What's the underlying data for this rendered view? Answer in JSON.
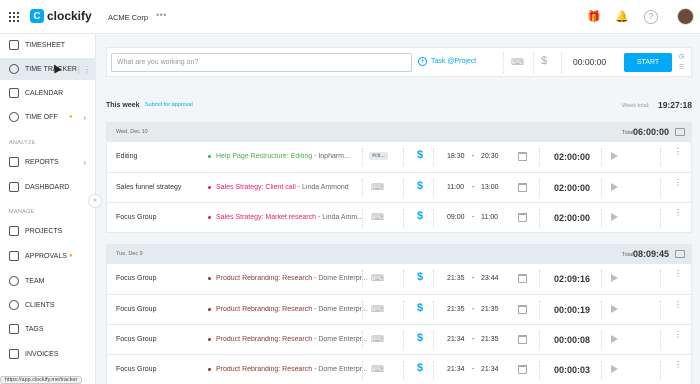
{
  "app": {
    "brand": "clockify",
    "workspace": "ACME Corp",
    "workspace_menu": "•••"
  },
  "topbar": {
    "icons": [
      "apps-grid-icon",
      "workspace-dots-icon",
      "gift-icon",
      "bell-icon",
      "help-icon",
      "avatar"
    ]
  },
  "sidebar": {
    "items": [
      {
        "label": "TIMESHEET",
        "icon": "timesheet-icon"
      },
      {
        "label": "TIME TRACKER",
        "icon": "clock-icon",
        "active": true
      },
      {
        "label": "CALENDAR",
        "icon": "calendar-icon"
      },
      {
        "label": "TIME OFF",
        "icon": "time-off-icon"
      }
    ],
    "sections": {
      "analyze": "ANALYZE",
      "manage": "MANAGE"
    },
    "analyze_items": [
      {
        "label": "REPORTS",
        "icon": "reports-icon"
      },
      {
        "label": "DASHBOARD",
        "icon": "dashboard-icon"
      }
    ],
    "manage_items": [
      {
        "label": "PROJECTS",
        "icon": "projects-icon"
      },
      {
        "label": "APPROVALS",
        "icon": "approvals-icon"
      },
      {
        "label": "TEAM",
        "icon": "team-icon"
      },
      {
        "label": "CLIENTS",
        "icon": "clients-icon"
      },
      {
        "label": "TAGS",
        "icon": "tags-icon"
      },
      {
        "label": "INVOICES",
        "icon": "invoices-icon"
      }
    ],
    "collapse": "«"
  },
  "tracker": {
    "placeholder": "What are you working on?",
    "project_label": "Task @Project",
    "time": "00:00:00",
    "start_label": "START",
    "accent": "#03a9f4"
  },
  "week": {
    "label": "This week",
    "approval_link": "Submit for approval",
    "total_label": "Week total:",
    "total": "19:27:18"
  },
  "days": [
    {
      "date": "Wed, Dec 10",
      "total_label": "Total:",
      "total": "06:00:00",
      "entries": [
        {
          "desc": "Editing",
          "project": "Help Page Restructure: Editing",
          "client": "- Inpharm...",
          "color": "#4caf50",
          "tag": "#cli...",
          "start": "18:30",
          "end": "20:30",
          "duration": "02:00:00"
        },
        {
          "desc": "Sales funnel strategy",
          "project": "Sales Strategy: Client call",
          "client": "- Linda Ammond",
          "color": "#e91e63",
          "tag": "",
          "start": "11:00",
          "end": "13:00",
          "duration": "02:00:00"
        },
        {
          "desc": "Focus Group",
          "project": "Sales Strategy: Market research",
          "client": "- Linda Amm...",
          "color": "#e91e63",
          "tag": "",
          "start": "09:00",
          "end": "11:00",
          "duration": "02:00:00"
        }
      ]
    },
    {
      "date": "Tue, Dec 9",
      "total_label": "Total:",
      "total": "08:09:45",
      "entries": [
        {
          "desc": "Focus Group",
          "project": "Product Rebranding: Research",
          "client": "- Dome Enterpr...",
          "color": "#8d3b2f",
          "tag": "",
          "start": "21:35",
          "end": "23:44",
          "duration": "02:09:16"
        },
        {
          "desc": "Focus Group",
          "project": "Product Rebranding: Research",
          "client": "- Dome Enterpr...",
          "color": "#8d3b2f",
          "tag": "",
          "start": "21:35",
          "end": "21:35",
          "duration": "00:00:19"
        },
        {
          "desc": "Focus Group",
          "project": "Product Rebranding: Research",
          "client": "- Dome Enterpr...",
          "color": "#8d3b2f",
          "tag": "",
          "start": "21:34",
          "end": "21:35",
          "duration": "00:00:08"
        },
        {
          "desc": "Focus Group",
          "project": "Product Rebranding: Research",
          "client": "- Dome Enterpr...",
          "color": "#8d3b2f",
          "tag": "",
          "start": "21:34",
          "end": "21:34",
          "duration": "00:00:03"
        }
      ]
    }
  ],
  "statusbar": {
    "url": "https://app.clockify.me/tracker"
  }
}
